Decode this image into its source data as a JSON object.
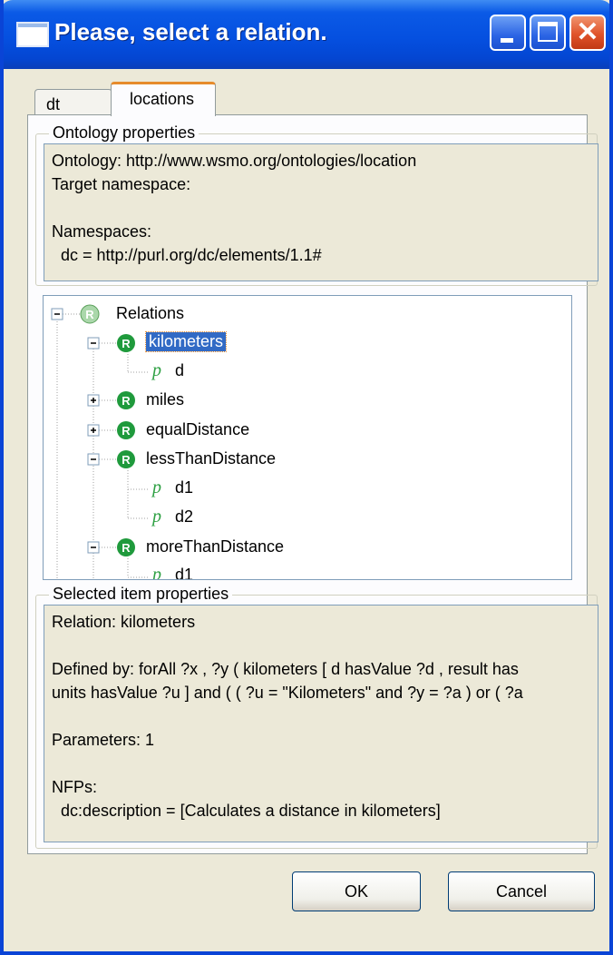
{
  "window": {
    "title": "Please, select a relation."
  },
  "tabs": [
    {
      "label": "dt"
    },
    {
      "label": "locations"
    }
  ],
  "ontology_group": {
    "label": "Ontology properties",
    "lines": [
      "Ontology: http://www.wsmo.org/ontologies/location",
      "Target namespace:",
      "",
      "Namespaces:",
      "  dc = http://purl.org/dc/elements/1.1#"
    ]
  },
  "tree": {
    "root": "Relations",
    "nodes": [
      {
        "label": "kilometers",
        "expanded": true,
        "children": [
          "d"
        ]
      },
      {
        "label": "miles",
        "expanded": false
      },
      {
        "label": "equalDistance",
        "expanded": false
      },
      {
        "label": "lessThanDistance",
        "expanded": true,
        "children": [
          "d1",
          "d2"
        ]
      },
      {
        "label": "moreThanDistance",
        "expanded": true,
        "children": [
          "d1"
        ]
      }
    ],
    "selected": "kilometers",
    "relation_icon_letter": "R",
    "param_icon_letter": "p",
    "icon_color": "#2ea043"
  },
  "selected_group": {
    "label": "Selected item properties",
    "lines": [
      "Relation: kilometers",
      "",
      "Defined by: forAll ?x , ?y ( kilometers [ d hasValue ?d , result has",
      "units hasValue ?u ] and ( ( ?u = \"Kilometers\" and ?y = ?a ) or ( ?a",
      "",
      "Parameters: 1",
      "",
      "NFPs:",
      "  dc:description = [Calculates a distance in kilometers]"
    ]
  },
  "buttons": {
    "ok": "OK",
    "cancel": "Cancel"
  },
  "colors": {
    "titlebar": "#0550e0",
    "accent_tab": "#e68b2c",
    "selection": "#316ac5"
  }
}
